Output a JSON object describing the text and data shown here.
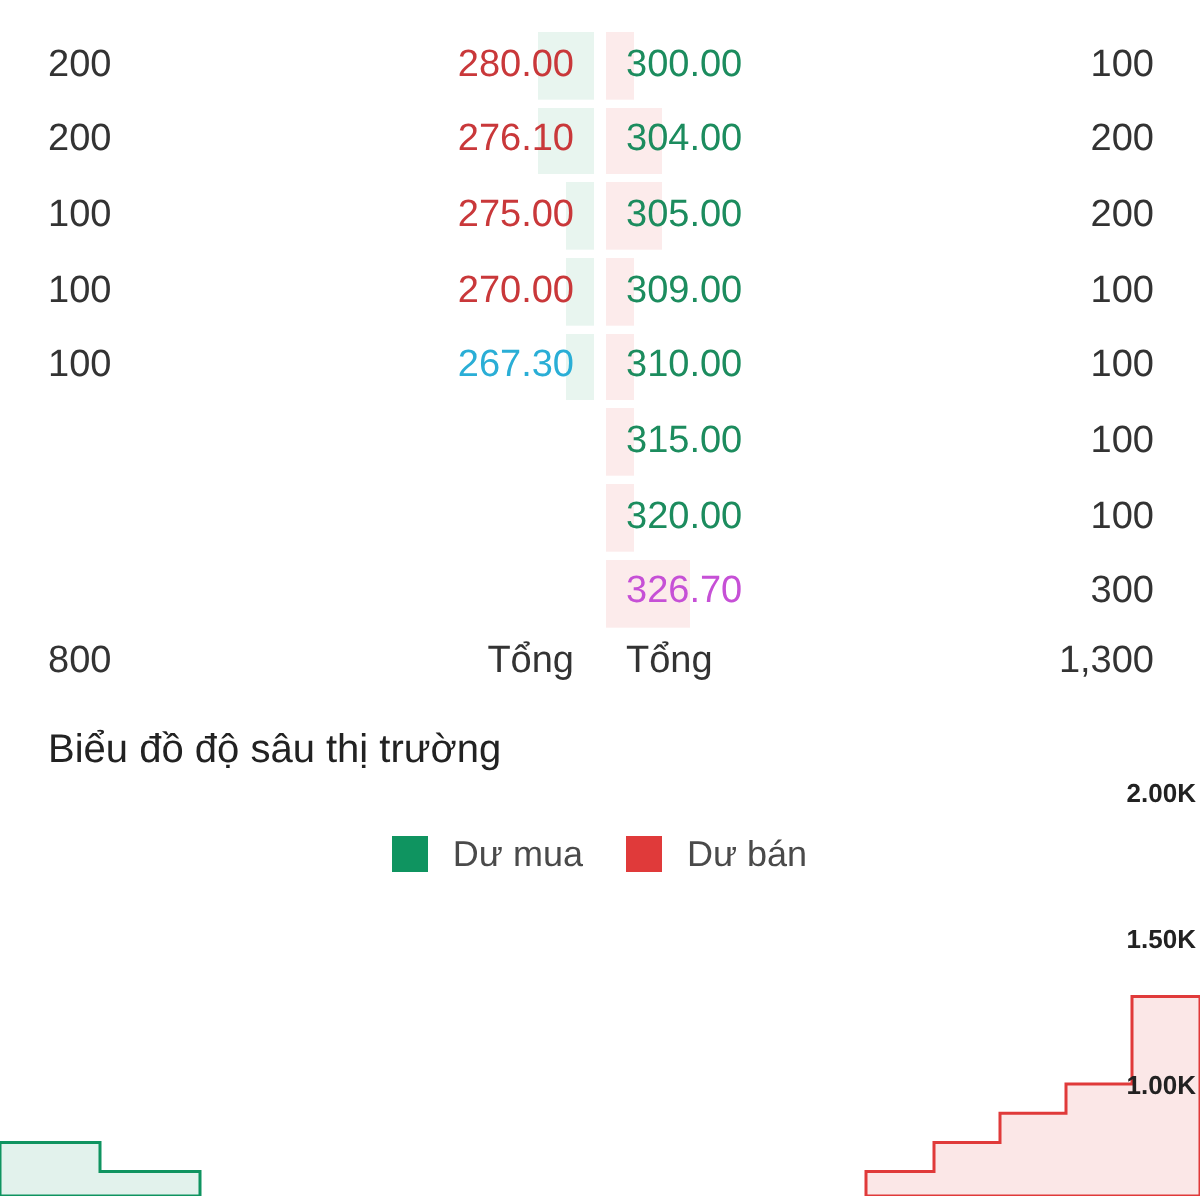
{
  "order_book": {
    "rows": [
      {
        "buy": {
          "volume": "200",
          "price": "280.00",
          "kind": "down"
        },
        "sell": {
          "price": "300.00",
          "kind": "up",
          "volume": "100"
        }
      },
      {
        "buy": {
          "volume": "200",
          "price": "276.10",
          "kind": "down"
        },
        "sell": {
          "price": "304.00",
          "kind": "up",
          "volume": "200"
        }
      },
      {
        "buy": {
          "volume": "100",
          "price": "275.00",
          "kind": "down"
        },
        "sell": {
          "price": "305.00",
          "kind": "up",
          "volume": "200"
        }
      },
      {
        "buy": {
          "volume": "100",
          "price": "270.00",
          "kind": "down"
        },
        "sell": {
          "price": "309.00",
          "kind": "up",
          "volume": "100"
        }
      },
      {
        "buy": {
          "volume": "100",
          "price": "267.30",
          "kind": "floor"
        },
        "sell": {
          "price": "310.00",
          "kind": "up",
          "volume": "100"
        }
      },
      {
        "sell": {
          "price": "315.00",
          "kind": "up",
          "volume": "100"
        }
      },
      {
        "sell": {
          "price": "320.00",
          "kind": "up",
          "volume": "100"
        }
      },
      {
        "sell": {
          "price": "326.70",
          "kind": "ceiling",
          "volume": "300"
        }
      }
    ],
    "totals": {
      "buy_volume": "800",
      "buy_label": "Tổng",
      "sell_label": "Tổng",
      "sell_volume": "1,300"
    }
  },
  "depth_chart": {
    "title": "Biểu đồ độ sâu thị trường",
    "legend": [
      {
        "label": "Dư mua",
        "color": "#0f9460"
      },
      {
        "label": "Dư bán",
        "color": "#e03a3a"
      }
    ],
    "axis_labels": [
      "2.00K",
      "1.50K",
      "1.00K"
    ]
  }
}
